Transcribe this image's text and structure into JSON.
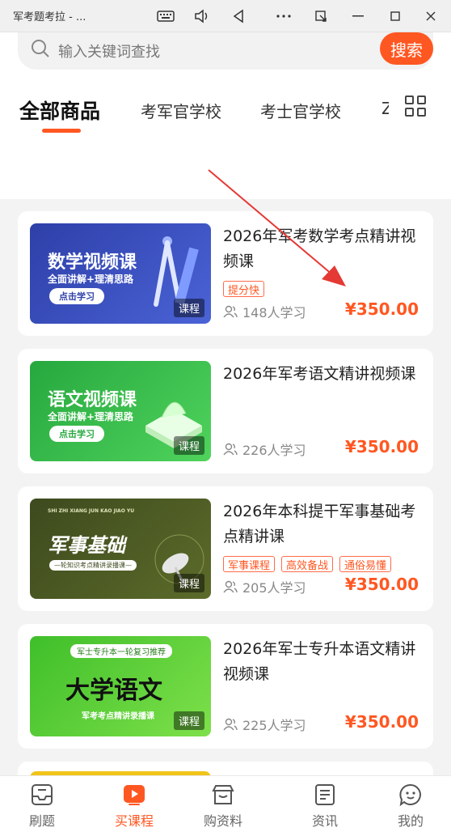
{
  "window": {
    "title": "军考题考拉 - ..."
  },
  "search": {
    "placeholder": "输入关键词查找",
    "button_label": "搜索"
  },
  "tabs": [
    {
      "label": "全部商品",
      "active": true
    },
    {
      "label": "考军官学校",
      "active": false
    },
    {
      "label": "考士官学校",
      "active": false
    },
    {
      "label": "Z",
      "active": false
    }
  ],
  "products": [
    {
      "title": "2026年军考数学考点精讲视频课",
      "tags": [
        "提分快"
      ],
      "learners": "148人学习",
      "price": "¥350.00",
      "thumb": {
        "title": "数学视频课",
        "subtitle": "全面讲解+理清思路",
        "button": "点击学习",
        "badge": "课程"
      }
    },
    {
      "title": "2026年军考语文精讲视频课",
      "tags": [],
      "learners": "226人学习",
      "price": "¥350.00",
      "thumb": {
        "title": "语文视频课",
        "subtitle": "全面讲解+理清思路",
        "button": "点击学习",
        "badge": "课程"
      }
    },
    {
      "title": "2026年本科提干军事基础考点精讲课",
      "tags": [
        "军事课程",
        "高效备战",
        "通俗易懂"
      ],
      "learners": "205人学习",
      "price": "¥350.00",
      "thumb": {
        "title": "军事基础",
        "tagline": "—轮知识考点精讲录播课—",
        "badge": "课程",
        "top_text": "SHI ZHI XIANG JUN KAO JIAO YU"
      }
    },
    {
      "title": "2026年军士专升本语文精讲视频课",
      "tags": [],
      "learners": "225人学习",
      "price": "¥350.00",
      "thumb": {
        "title": "大学语文",
        "top_text": "军士专升本一轮复习推荐",
        "bottom_text": "军考考点精讲录播课",
        "badge": "课程"
      }
    }
  ],
  "bottom_nav": [
    {
      "label": "刷题",
      "icon": "inbox-icon",
      "active": false
    },
    {
      "label": "买课程",
      "icon": "play-icon",
      "active": true
    },
    {
      "label": "购资料",
      "icon": "store-icon",
      "active": false
    },
    {
      "label": "资讯",
      "icon": "news-icon",
      "active": false
    },
    {
      "label": "我的",
      "icon": "chat-face-icon",
      "active": false
    }
  ],
  "colors": {
    "accent": "#ff5722"
  }
}
